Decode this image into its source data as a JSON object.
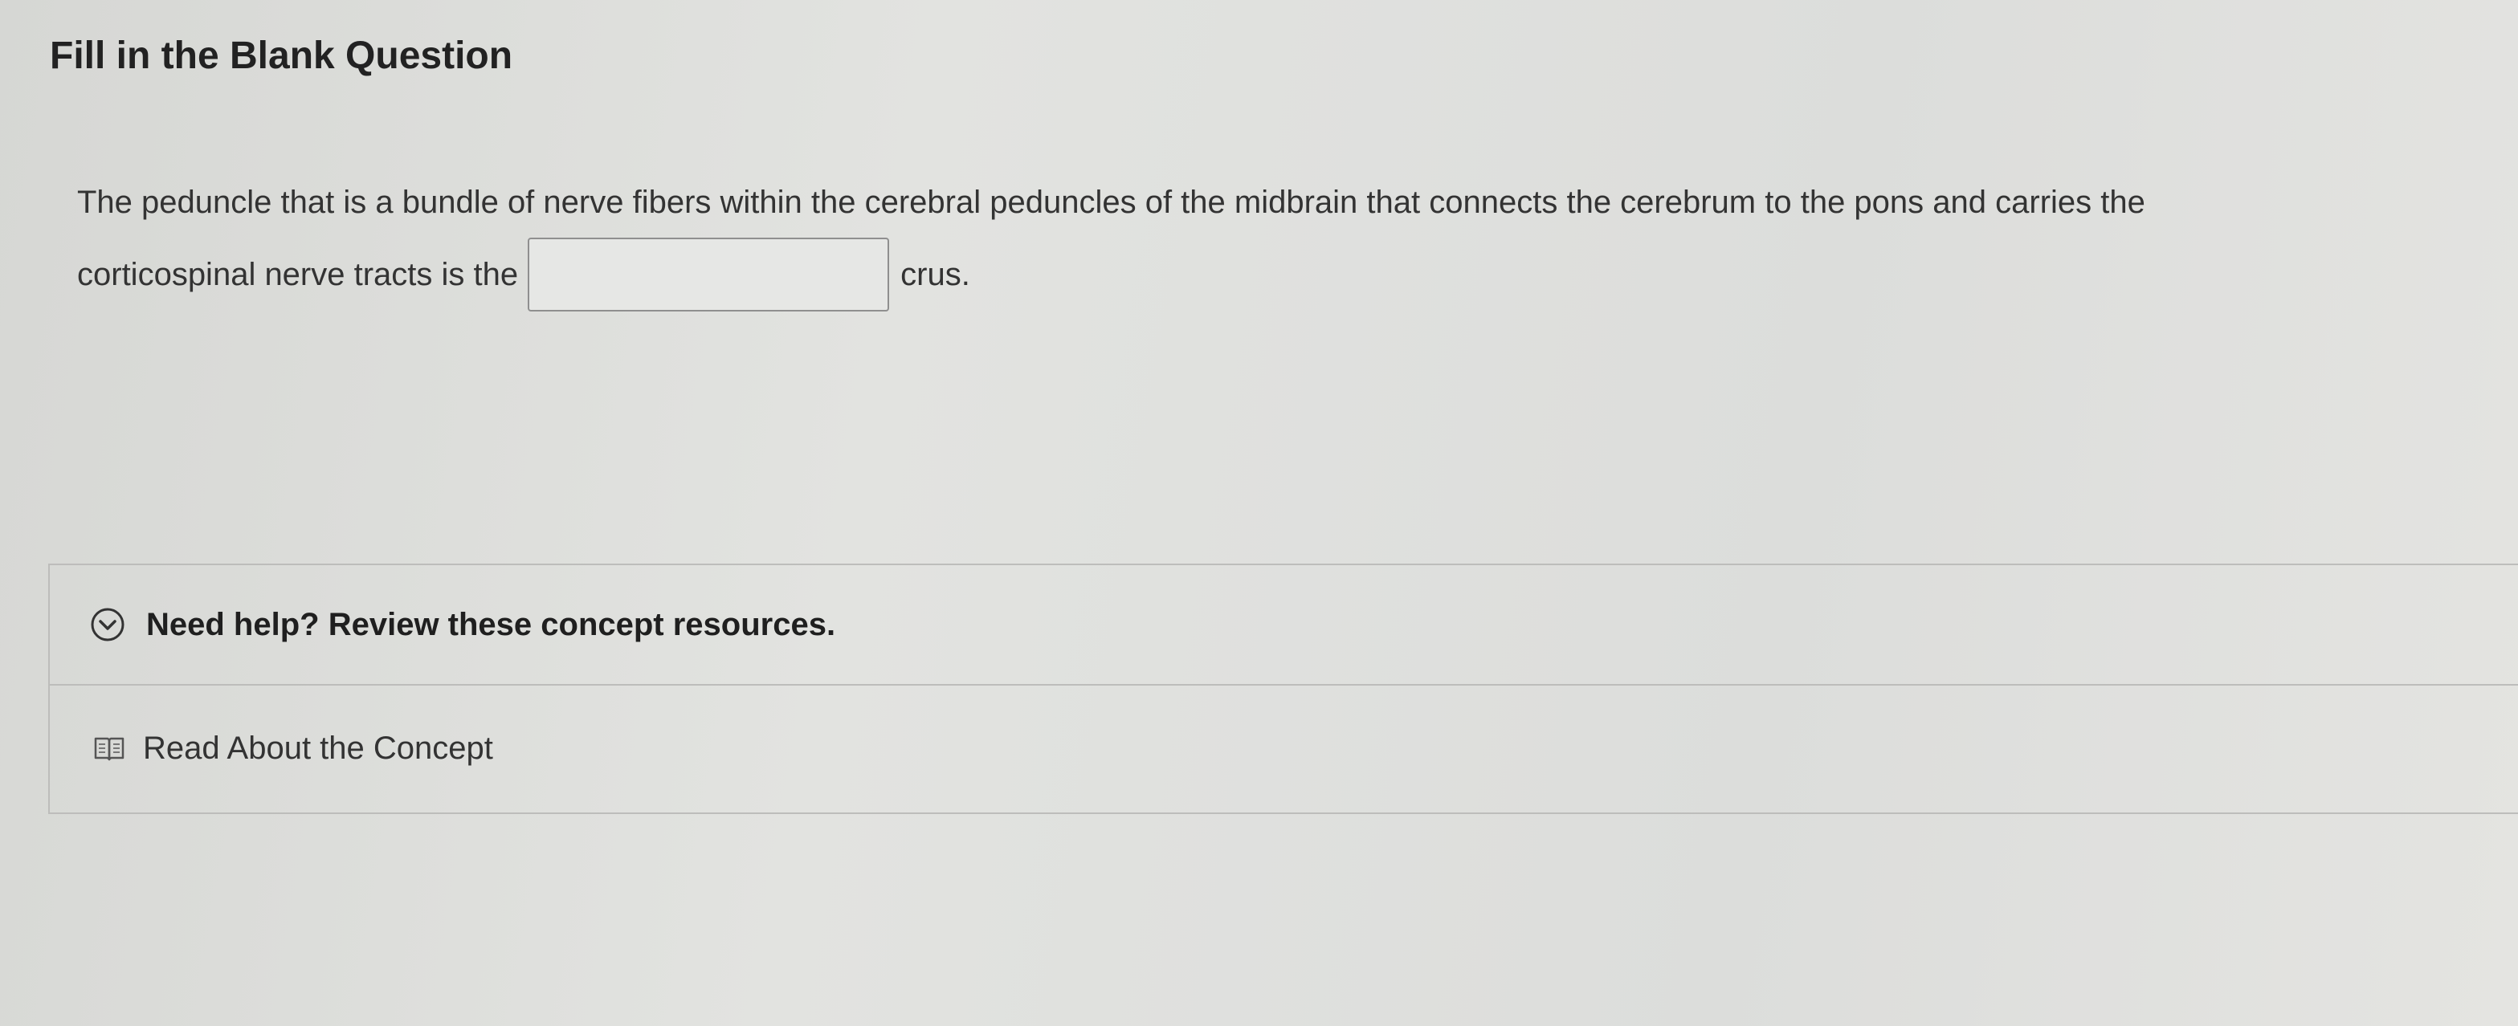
{
  "heading": "Fill in the Blank Question",
  "question": {
    "text_line1": "The peduncle that is a bundle of nerve fibers within the cerebral peduncles of the midbrain that connects the cerebrum to the pons and carries the",
    "text_before_blank": "corticospinal nerve tracts is the",
    "blank_value": "",
    "text_after_blank": "crus."
  },
  "help": {
    "header_label": "Need help? Review these concept resources.",
    "header_icon": "chevron-down-circle-icon",
    "resources": [
      {
        "label": "Read About the Concept",
        "icon": "book-icon"
      }
    ]
  }
}
